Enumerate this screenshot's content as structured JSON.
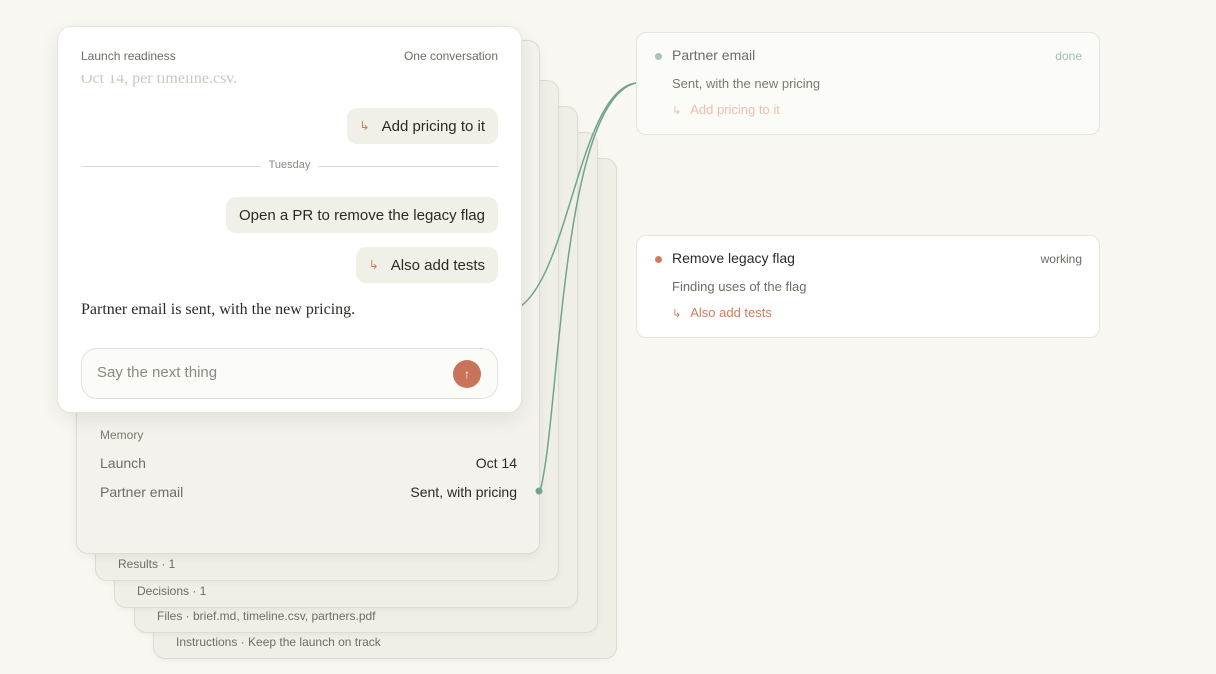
{
  "chat": {
    "title": "Launch readiness",
    "subtitle": "One conversation",
    "faded_text": "Oct 14, per timeline.csv.",
    "messages": {
      "add_pricing": "Add pricing to it",
      "open_pr": "Open a PR to remove the legacy flag",
      "add_tests": "Also add tests"
    },
    "divider_label": "Tuesday",
    "reply": "Partner email is sent, with the new pricing.",
    "input_placeholder": "Say the next thing",
    "send_icon": "↑",
    "branch_icon": "↳"
  },
  "memory": {
    "heading": "Memory",
    "rows": [
      {
        "key": "Launch",
        "value": "Oct 14"
      },
      {
        "key": "Partner email",
        "value": "Sent, with pricing"
      }
    ]
  },
  "layers": {
    "results": "Results · 1",
    "decisions": "Decisions · 1",
    "files": "Files · brief.md, timeline.csv, partners.pdf",
    "instructions": "Instructions · Keep the launch on track"
  },
  "tasks": [
    {
      "title": "Partner email",
      "status": "done",
      "description": "Sent, with the new pricing",
      "followup": "Add pricing to it"
    },
    {
      "title": "Remove legacy flag",
      "status": "working",
      "description": "Finding uses of the flag",
      "followup": "Also add tests"
    }
  ],
  "colors": {
    "accent": "#c9745a",
    "link": "#6fa58e",
    "done": "#a7c4b6"
  }
}
